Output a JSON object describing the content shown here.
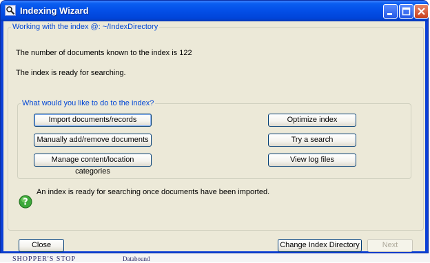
{
  "window": {
    "title": "Indexing Wizard"
  },
  "index_group": {
    "legend": "Working with the index @: ~/IndexDirectory",
    "doc_count_text": "The number of documents known to the index is 122",
    "status_text": "The index is ready for searching."
  },
  "actions_group": {
    "legend": "What would you like to do to the index?",
    "import_label": "Import documents/records",
    "manual_label": "Manually add/remove documents",
    "categories_label": "Manage content/location categories",
    "optimize_label": "Optimize index",
    "search_label": "Try a search",
    "logs_label": "View log files"
  },
  "help_text": "An index is ready for searching once documents have been imported.",
  "footer": {
    "close_label": "Close",
    "change_dir_label": "Change Index Directory",
    "next_label": "Next"
  },
  "background": {
    "left_text": "SHOPPER'S STOP",
    "right_text": "Databound"
  },
  "colors": {
    "legend": "#0046d5",
    "titlebar": "#0450e8",
    "dialog_bg": "#ece9d8"
  }
}
